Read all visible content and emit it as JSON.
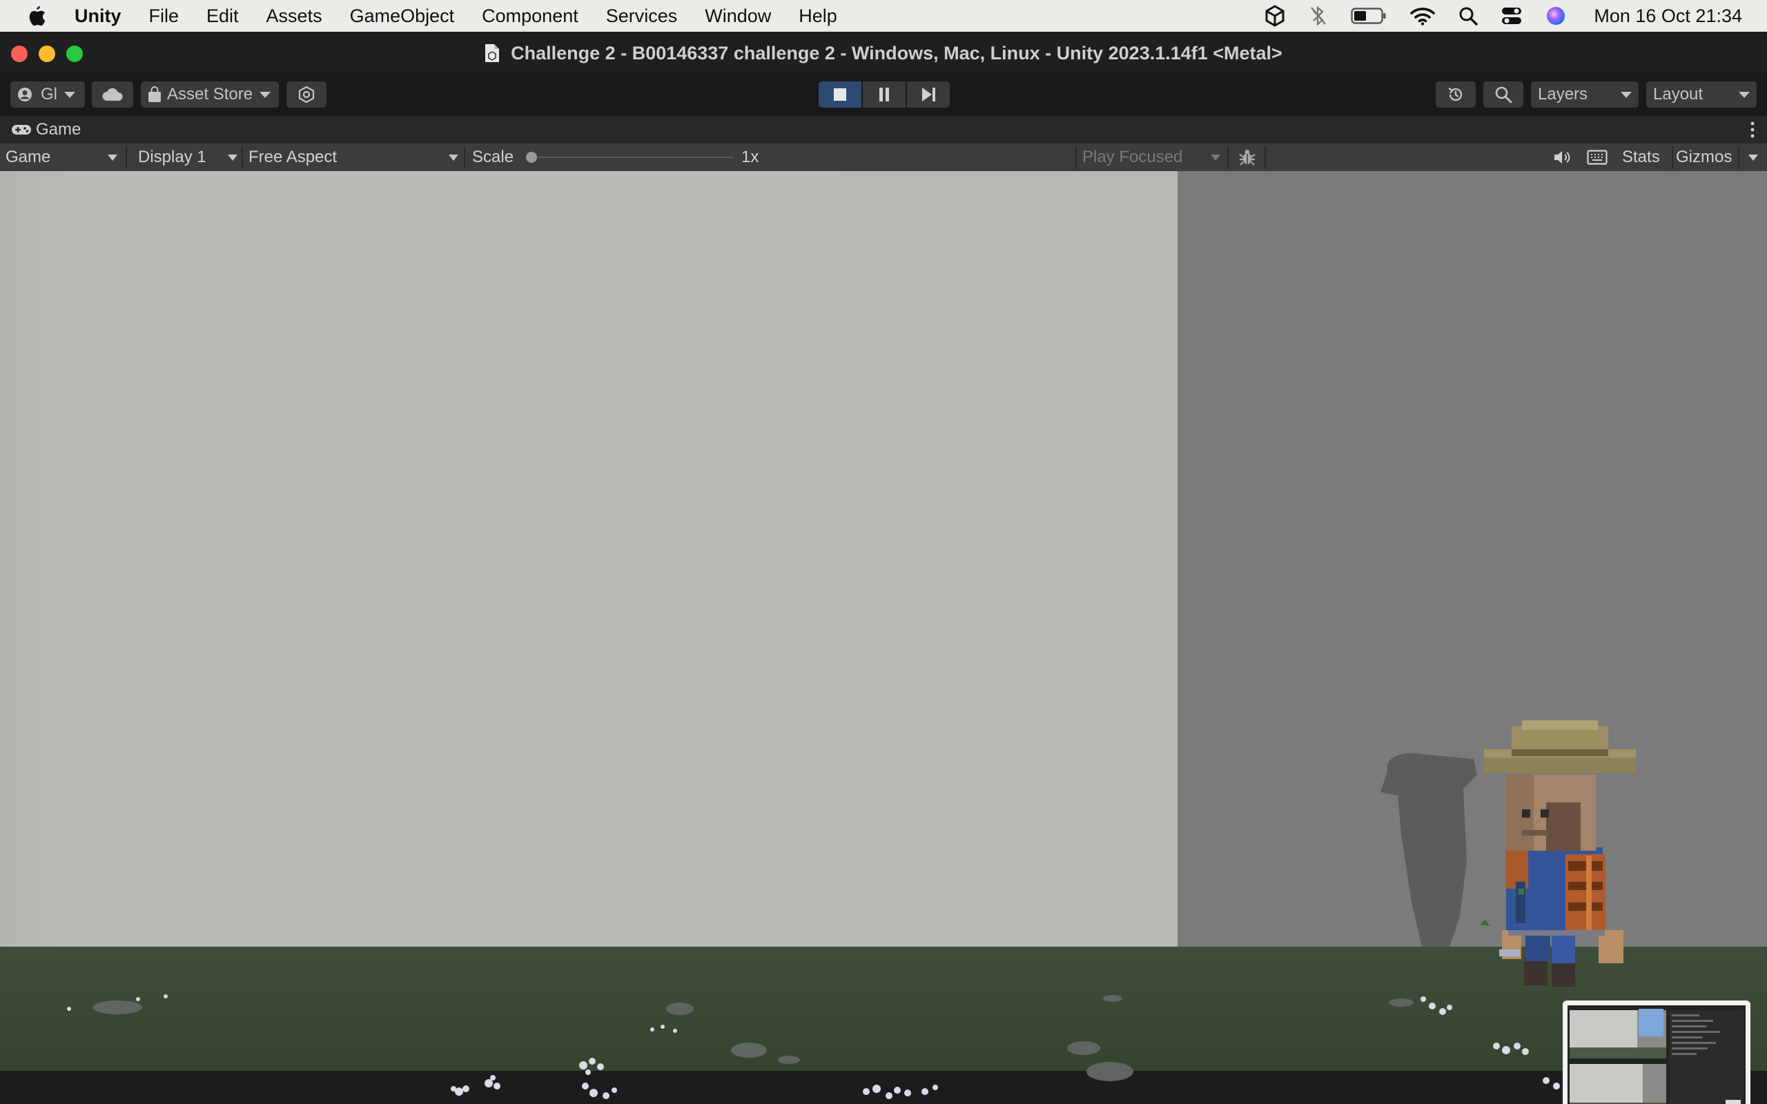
{
  "menubar": {
    "app_name": "Unity",
    "items": [
      "File",
      "Edit",
      "Assets",
      "GameObject",
      "Component",
      "Services",
      "Window",
      "Help"
    ],
    "clock": "Mon 16 Oct  21:34"
  },
  "window": {
    "title": "Challenge 2 - B00146337 challenge 2 - Windows, Mac, Linux - Unity 2023.1.14f1 <Metal>"
  },
  "toolbar": {
    "account_label": "Gl",
    "asset_store_label": "Asset Store",
    "layers_label": "Layers",
    "layout_label": "Layout"
  },
  "game_tab": {
    "label": "Game"
  },
  "game_bar": {
    "mode_label": "Game",
    "display_label": "Display 1",
    "aspect_label": "Free Aspect",
    "scale_label": "Scale",
    "scale_value": "1x",
    "play_focused_label": "Play Focused",
    "stats_label": "Stats",
    "gizmos_label": "Gizmos"
  },
  "colors": {
    "play_accent": "#2c4a72",
    "sky": "#b8b9b4",
    "wall": "#7b7b7b",
    "ground": "#3d4c38"
  }
}
